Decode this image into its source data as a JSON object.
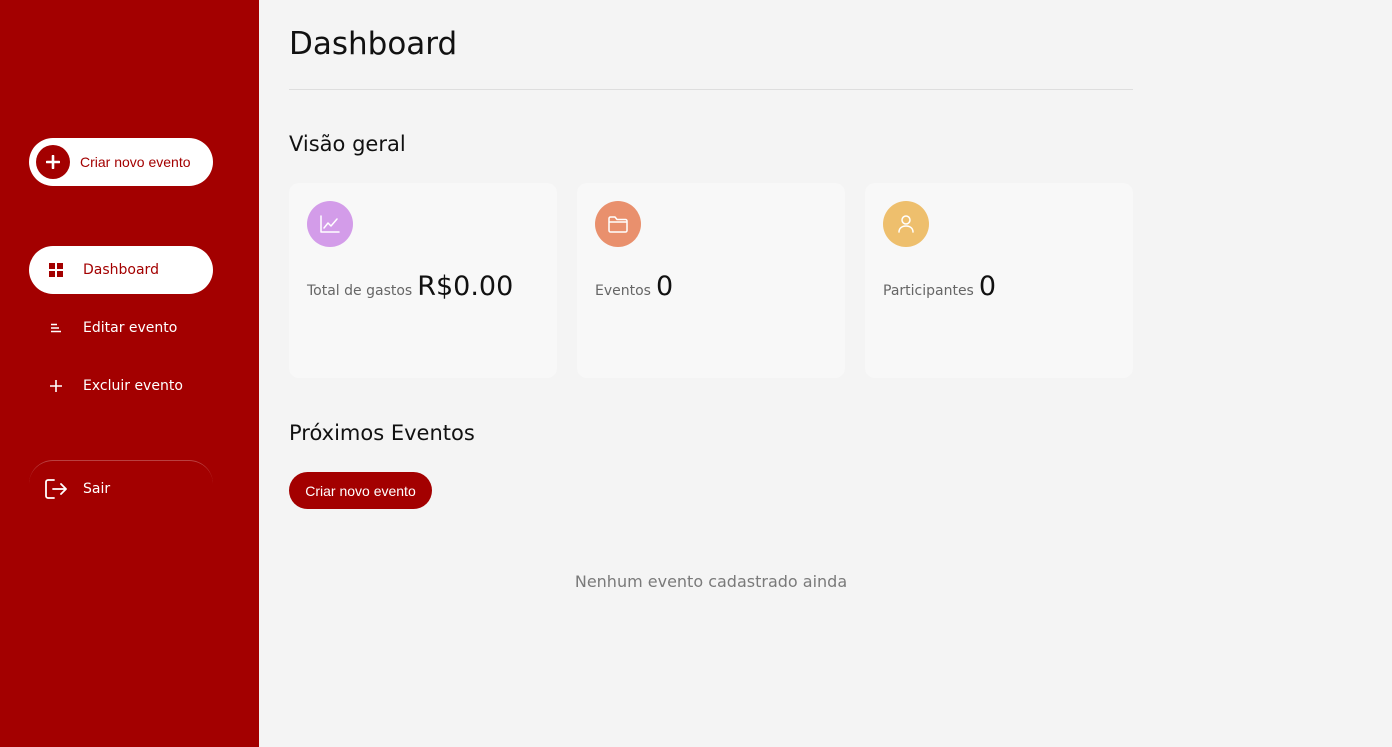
{
  "sidebar": {
    "create_button": {
      "label": "Criar novo evento",
      "icon": "plus-icon"
    },
    "items": [
      {
        "label": "Dashboard",
        "icon": "grid-icon",
        "active": true
      },
      {
        "label": "Editar evento",
        "icon": "list-icon",
        "active": false
      },
      {
        "label": "Excluir evento",
        "icon": "plus-icon",
        "active": false
      }
    ],
    "logout": {
      "label": "Sair",
      "icon": "logout-icon"
    }
  },
  "main": {
    "title": "Dashboard",
    "overview": {
      "title": "Visão geral",
      "cards": [
        {
          "label": "Total de gastos",
          "value": "R$0.00",
          "icon": "chart-icon",
          "color": "#d39ce9"
        },
        {
          "label": "Eventos",
          "value": "0",
          "icon": "folder-icon",
          "color": "#e9906d"
        },
        {
          "label": "Participantes",
          "value": "0",
          "icon": "user-icon",
          "color": "#eebf6d"
        }
      ]
    },
    "upcoming": {
      "title": "Próximos Eventos",
      "button_label": "Criar novo evento",
      "empty_message": "Nenhum evento cadastrado ainda"
    }
  },
  "colors": {
    "brand": "#a30000",
    "background": "#f4f4f4"
  }
}
